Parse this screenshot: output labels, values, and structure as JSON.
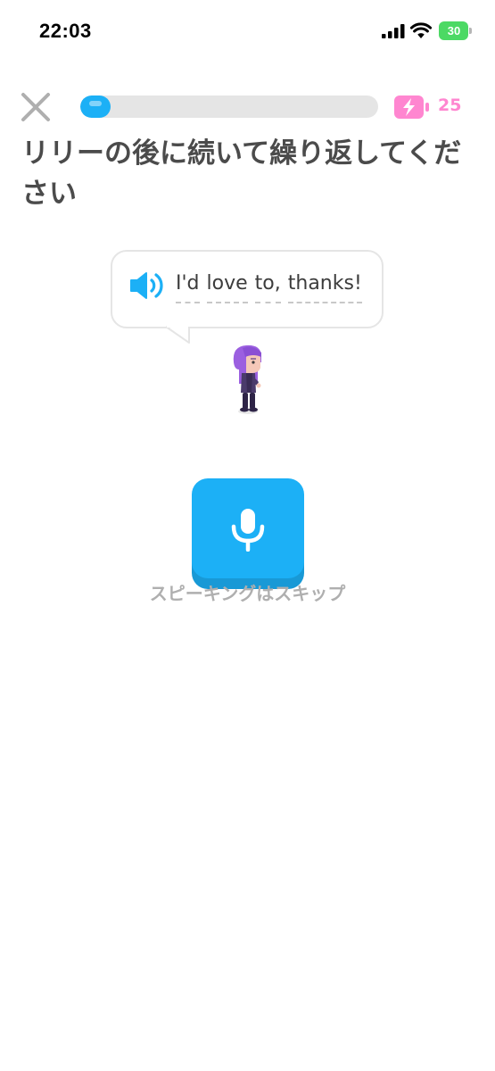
{
  "status_bar": {
    "time": "22:03",
    "battery_level": "30",
    "battery_color": "#4cd964",
    "icons": [
      "signal-icon",
      "wifi-icon",
      "battery-icon"
    ]
  },
  "lesson_header": {
    "close_icon": "close-icon",
    "progress_fraction": 0.1,
    "progress_color": "#1cb0f6",
    "energy_icon": "battery-bolt-icon",
    "energy_count": "25",
    "energy_color": "#ff86d0"
  },
  "instruction": {
    "text": "リリーの後に続いて繰り返してください"
  },
  "prompt": {
    "speaker_icon": "speaker-icon",
    "words": [
      "I'd",
      "love",
      "to,",
      "thanks!"
    ]
  },
  "character": {
    "name": "Lily",
    "icon": "lily-character"
  },
  "actions": {
    "mic_icon": "microphone-icon",
    "mic_color": "#1cb0f6",
    "skip_label": "スピーキングはスキップ"
  }
}
